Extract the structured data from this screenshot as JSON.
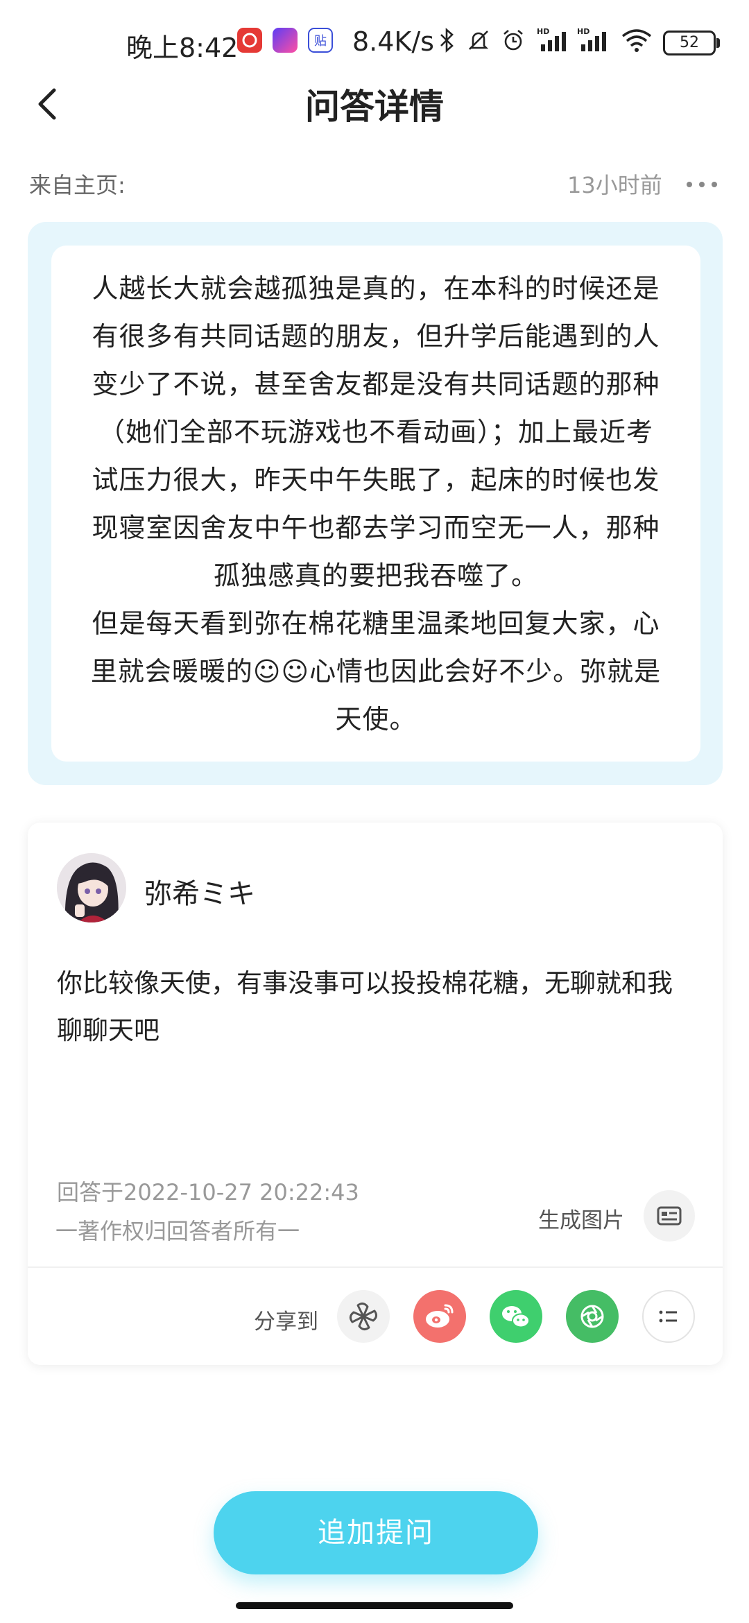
{
  "status_bar": {
    "time": "晚上8:42",
    "network_speed": "8.4K/s",
    "battery": "52",
    "icons": [
      "netease-music-icon",
      "purple-app-icon",
      "tieba-icon",
      "bluetooth-icon",
      "mute-icon",
      "alarm-icon",
      "hd-signal-icon",
      "hd-signal-icon",
      "wifi-icon"
    ]
  },
  "header": {
    "title": "问答详情"
  },
  "meta": {
    "from": "来自主页:",
    "time_ago": "13小时前"
  },
  "question": {
    "lines": [
      "人越长大就会越孤独是真的，在本科的时候还是",
      "有很多有共同话题的朋友，但升学后能遇到的人",
      "变少了不说，甚至舍友都是没有共同话题的那种",
      "（她们全部不玩游戏也不看动画）；加上最近考",
      "试压力很大，昨天中午失眠了，起床的时候也发",
      "现寝室因舍友中午也都去学习而空无一人，那种",
      "孤独感真的要把我吞噬了。",
      "但是每天看到弥在棉花糖里温柔地回复大家，心",
      "里就会暖暖的☺☺心情也因此会好不少。弥就是",
      "天使。"
    ]
  },
  "answer": {
    "author": "弥希ミキ",
    "text_lines": [
      "你比较像天使，有事没事可以投投棉花糖，无聊就和我",
      "聊聊天吧"
    ],
    "date": "回答于2022-10-27 20:22:43",
    "copyright": "一著作权归回答者所有一",
    "generate_image_label": "生成图片"
  },
  "share": {
    "label": "分享到",
    "targets": [
      {
        "name": "pinwheel",
        "color": "#f2f2f2"
      },
      {
        "name": "weibo",
        "color": "#f3716d"
      },
      {
        "name": "wechat",
        "color": "#3fcf6e"
      },
      {
        "name": "moments",
        "color": "#45bd65"
      },
      {
        "name": "list",
        "color": "#ffffff"
      }
    ]
  },
  "cta": {
    "label": "追加提问"
  }
}
